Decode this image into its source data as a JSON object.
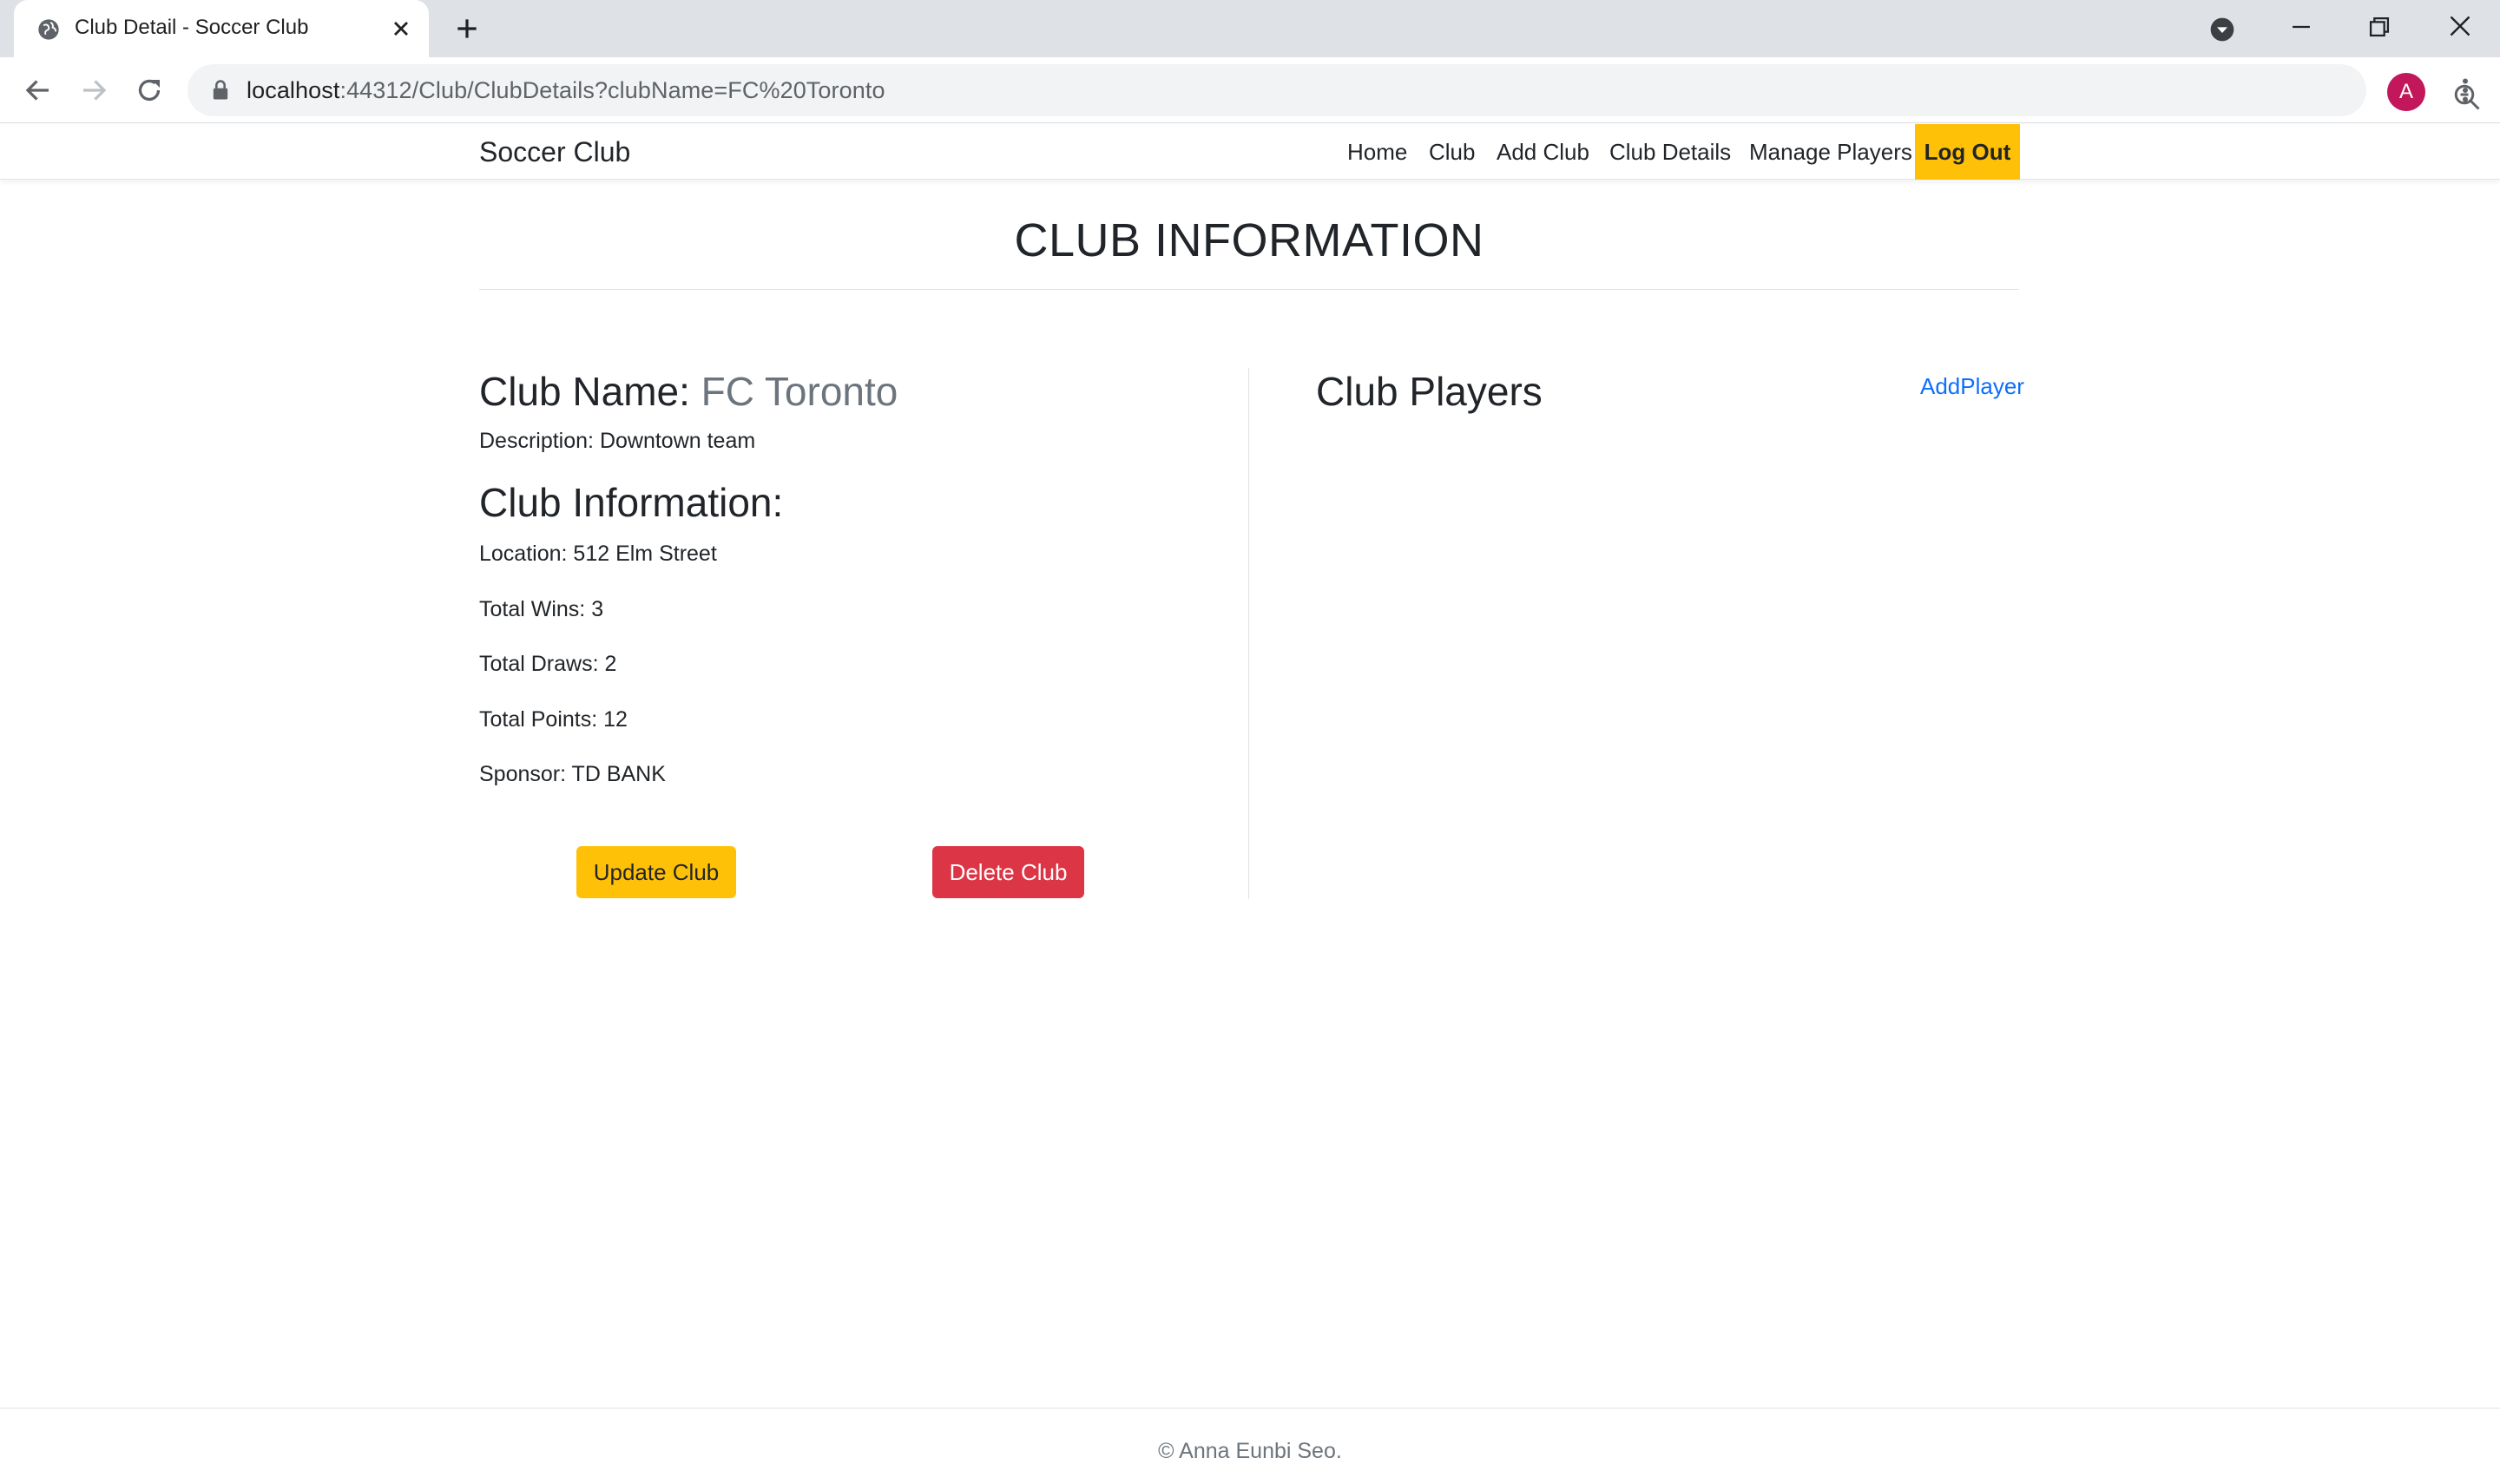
{
  "browser": {
    "tab_title": "Club Detail - Soccer Club",
    "url_host": "localhost",
    "url_rest": ":44312/Club/ClubDetails?clubName=FC%20Toronto",
    "avatar_letter": "A"
  },
  "navbar": {
    "brand": "Soccer Club",
    "links": [
      "Home",
      "Club",
      "Add Club",
      "Club Details",
      "Manage Players"
    ],
    "logout": "Log Out",
    "logout_color": "#ffc107"
  },
  "page": {
    "title": "CLUB INFORMATION"
  },
  "club": {
    "name_label": "Club Name:",
    "name_value": "FC Toronto",
    "description": "Description: Downtown team",
    "info_heading": "Club Information:",
    "location": "Location: 512 Elm Street",
    "wins": "Total Wins: 3",
    "draws": "Total Draws: 2",
    "points": "Total Points: 12",
    "sponsor": "Sponsor: TD BANK"
  },
  "actions": {
    "update_label": "Update Club",
    "update_color": "#ffc107",
    "delete_label": "Delete Club",
    "delete_color": "#dc3545"
  },
  "players": {
    "heading": "Club Players",
    "add_link": "AddPlayer"
  },
  "footer": {
    "text": "© Anna Eunbi Seo."
  }
}
